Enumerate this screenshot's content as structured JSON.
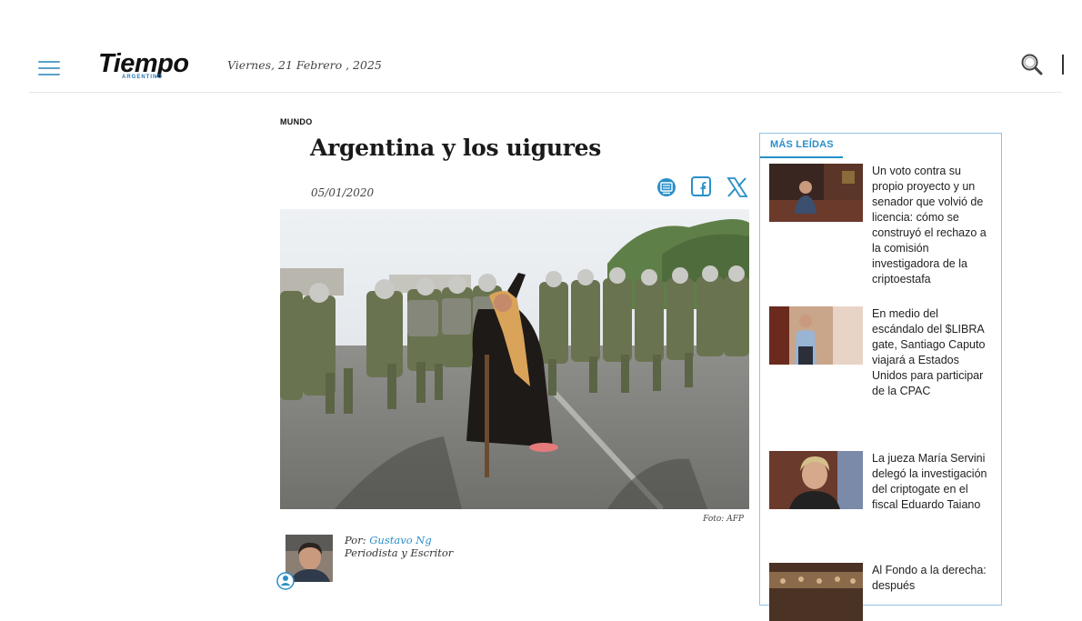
{
  "header": {
    "logo_text": "Tiempo",
    "logo_sub": "ARGENTINO",
    "date": "Viernes, 21 Febrero , 2025",
    "icons": {
      "menu": "hamburger-menu-icon",
      "search": "search-icon"
    }
  },
  "article": {
    "section": "MUNDO",
    "title": "Argentina y los uigures",
    "date": "05/01/2020",
    "share_icons": [
      "news-icon",
      "facebook-icon",
      "x-icon"
    ],
    "photo_caption": "Foto: AFP",
    "author": {
      "prefix": "Por:",
      "name": "Gustavo Ng",
      "role": "Periodista y Escritor"
    }
  },
  "sidebar": {
    "title": "MÁS LEÍDAS",
    "items": [
      {
        "text": "Un voto contra su propio proyecto y un senador que volvió de licencia: cómo se construyó el rechazo a la comisión investigadora de la criptoestafa"
      },
      {
        "text": "En medio del escándalo del $LIBRA gate, Santiago Caputo viajará a Estados Unidos para participar de la CPAC"
      },
      {
        "text": "La jueza María Servini delegó la investigación del criptogate en el fiscal Eduardo Taiano"
      },
      {
        "text": "Al Fondo a la derecha: después"
      }
    ]
  },
  "colors": {
    "accent": "#2a8fc8",
    "menu": "#5aa0c9",
    "sidebar_border": "#8fc4e3"
  }
}
